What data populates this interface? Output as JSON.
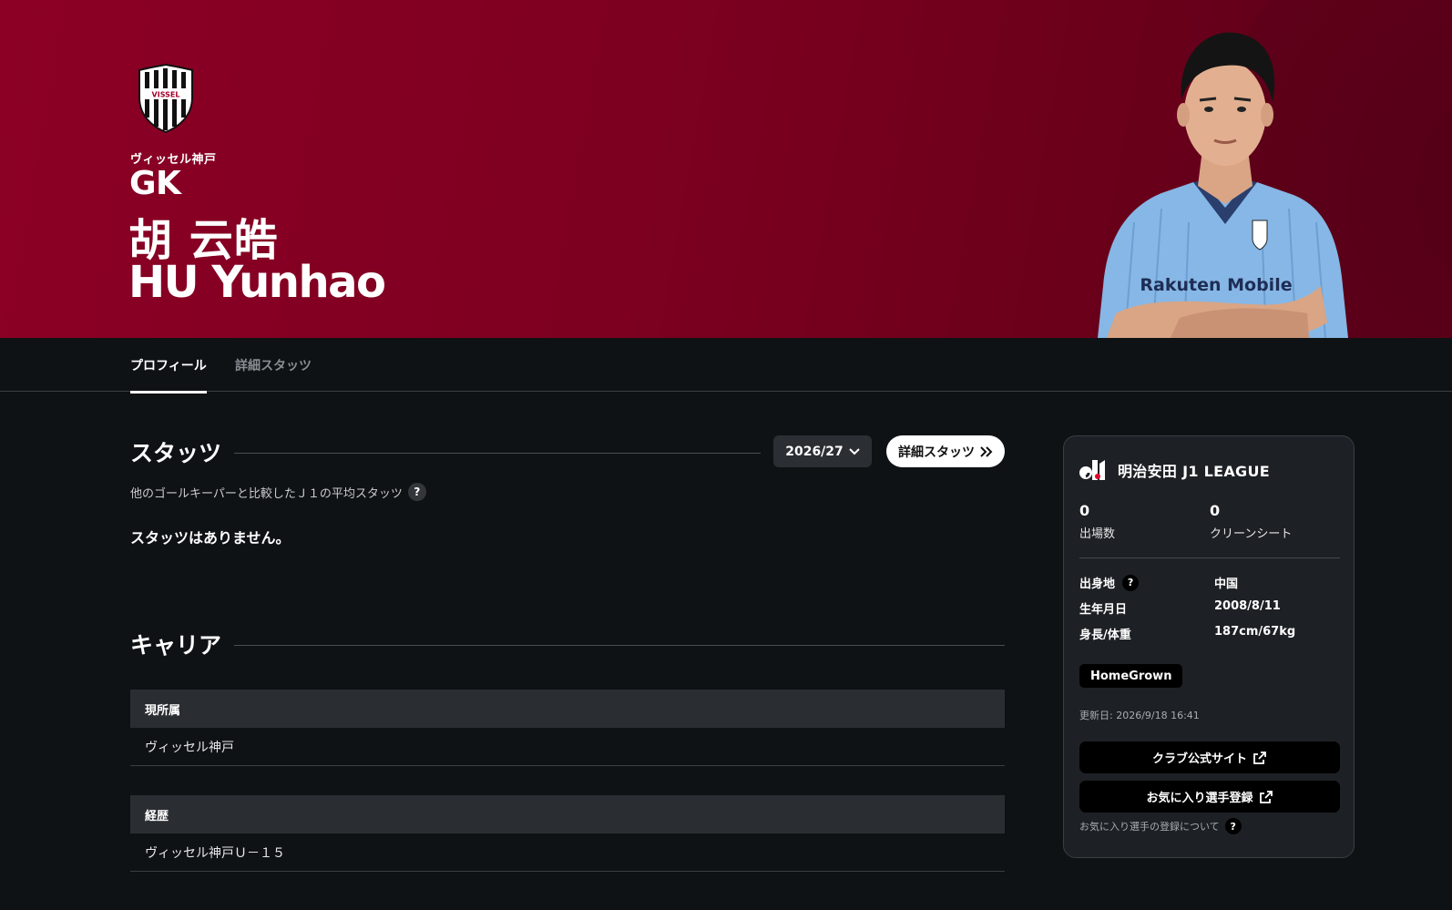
{
  "hero": {
    "club_name": "ヴィッセル神戸",
    "crest_text": "VISSEL",
    "position": "GK",
    "name_ja": "胡 云皓",
    "name_en": "HU Yunhao",
    "jersey_sponsor": "Rakuten Mobile",
    "colors": {
      "primary": "#8c0025",
      "dark": "#5a0018"
    }
  },
  "tabs": [
    {
      "label": "プロフィール",
      "active": true
    },
    {
      "label": "詳細スタッツ",
      "active": false
    }
  ],
  "stats": {
    "title": "スタッツ",
    "season": "2026/27",
    "detail_button": "詳細スタッツ",
    "subnote": "他のゴールキーパーと比較したＪ１の平均スタッツ",
    "help": "?",
    "empty_message": "スタッツはありません。"
  },
  "career": {
    "title": "キャリア",
    "current_label": "現所属",
    "current_value": "ヴィッセル神戸",
    "history_label": "経歴",
    "history_value": "ヴィッセル神戸Ｕ－１５"
  },
  "card": {
    "league_name": "明治安田 J1 LEAGUE",
    "appearances_value": "0",
    "appearances_label": "出場数",
    "clean_sheets_value": "0",
    "clean_sheets_label": "クリーンシート",
    "birthplace_label": "出身地",
    "birthplace_value": "中国",
    "birthdate_label": "生年月日",
    "birthdate_value": "2008/8/11",
    "body_label": "身長/体重",
    "body_value": "187cm/67kg",
    "badge": "HomeGrown",
    "updated": "更新日: 2026/9/18 16:41",
    "club_site_button": "クラブ公式サイト",
    "favorite_button": "お気に入り選手登録",
    "favorite_note": "お気に入り選手の登録について",
    "help": "?"
  }
}
